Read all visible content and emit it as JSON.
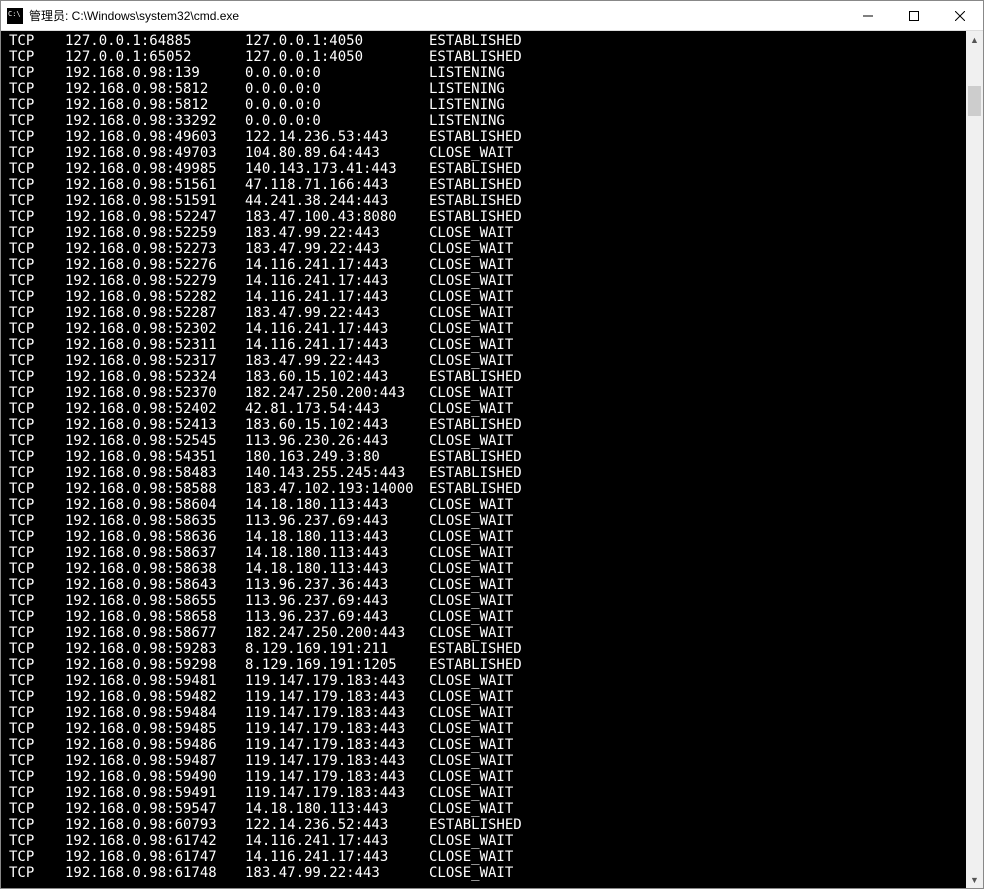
{
  "window": {
    "title": "管理员: C:\\Windows\\system32\\cmd.exe"
  },
  "connections": [
    {
      "proto": "TCP",
      "local": "127.0.0.1:64885",
      "remote": "127.0.0.1:4050",
      "state": "ESTABLISHED"
    },
    {
      "proto": "TCP",
      "local": "127.0.0.1:65052",
      "remote": "127.0.0.1:4050",
      "state": "ESTABLISHED"
    },
    {
      "proto": "TCP",
      "local": "192.168.0.98:139",
      "remote": "0.0.0.0:0",
      "state": "LISTENING"
    },
    {
      "proto": "TCP",
      "local": "192.168.0.98:5812",
      "remote": "0.0.0.0:0",
      "state": "LISTENING"
    },
    {
      "proto": "TCP",
      "local": "192.168.0.98:5812",
      "remote": "0.0.0.0:0",
      "state": "LISTENING"
    },
    {
      "proto": "TCP",
      "local": "192.168.0.98:33292",
      "remote": "0.0.0.0:0",
      "state": "LISTENING"
    },
    {
      "proto": "TCP",
      "local": "192.168.0.98:49603",
      "remote": "122.14.236.53:443",
      "state": "ESTABLISHED"
    },
    {
      "proto": "TCP",
      "local": "192.168.0.98:49703",
      "remote": "104.80.89.64:443",
      "state": "CLOSE_WAIT"
    },
    {
      "proto": "TCP",
      "local": "192.168.0.98:49985",
      "remote": "140.143.173.41:443",
      "state": "ESTABLISHED"
    },
    {
      "proto": "TCP",
      "local": "192.168.0.98:51561",
      "remote": "47.118.71.166:443",
      "state": "ESTABLISHED"
    },
    {
      "proto": "TCP",
      "local": "192.168.0.98:51591",
      "remote": "44.241.38.244:443",
      "state": "ESTABLISHED"
    },
    {
      "proto": "TCP",
      "local": "192.168.0.98:52247",
      "remote": "183.47.100.43:8080",
      "state": "ESTABLISHED"
    },
    {
      "proto": "TCP",
      "local": "192.168.0.98:52259",
      "remote": "183.47.99.22:443",
      "state": "CLOSE_WAIT"
    },
    {
      "proto": "TCP",
      "local": "192.168.0.98:52273",
      "remote": "183.47.99.22:443",
      "state": "CLOSE_WAIT"
    },
    {
      "proto": "TCP",
      "local": "192.168.0.98:52276",
      "remote": "14.116.241.17:443",
      "state": "CLOSE_WAIT"
    },
    {
      "proto": "TCP",
      "local": "192.168.0.98:52279",
      "remote": "14.116.241.17:443",
      "state": "CLOSE_WAIT"
    },
    {
      "proto": "TCP",
      "local": "192.168.0.98:52282",
      "remote": "14.116.241.17:443",
      "state": "CLOSE_WAIT"
    },
    {
      "proto": "TCP",
      "local": "192.168.0.98:52287",
      "remote": "183.47.99.22:443",
      "state": "CLOSE_WAIT"
    },
    {
      "proto": "TCP",
      "local": "192.168.0.98:52302",
      "remote": "14.116.241.17:443",
      "state": "CLOSE_WAIT"
    },
    {
      "proto": "TCP",
      "local": "192.168.0.98:52311",
      "remote": "14.116.241.17:443",
      "state": "CLOSE_WAIT"
    },
    {
      "proto": "TCP",
      "local": "192.168.0.98:52317",
      "remote": "183.47.99.22:443",
      "state": "CLOSE_WAIT"
    },
    {
      "proto": "TCP",
      "local": "192.168.0.98:52324",
      "remote": "183.60.15.102:443",
      "state": "ESTABLISHED"
    },
    {
      "proto": "TCP",
      "local": "192.168.0.98:52370",
      "remote": "182.247.250.200:443",
      "state": "CLOSE_WAIT"
    },
    {
      "proto": "TCP",
      "local": "192.168.0.98:52402",
      "remote": "42.81.173.54:443",
      "state": "CLOSE_WAIT"
    },
    {
      "proto": "TCP",
      "local": "192.168.0.98:52413",
      "remote": "183.60.15.102:443",
      "state": "ESTABLISHED"
    },
    {
      "proto": "TCP",
      "local": "192.168.0.98:52545",
      "remote": "113.96.230.26:443",
      "state": "CLOSE_WAIT"
    },
    {
      "proto": "TCP",
      "local": "192.168.0.98:54351",
      "remote": "180.163.249.3:80",
      "state": "ESTABLISHED"
    },
    {
      "proto": "TCP",
      "local": "192.168.0.98:58483",
      "remote": "140.143.255.245:443",
      "state": "ESTABLISHED"
    },
    {
      "proto": "TCP",
      "local": "192.168.0.98:58588",
      "remote": "183.47.102.193:14000",
      "state": "ESTABLISHED"
    },
    {
      "proto": "TCP",
      "local": "192.168.0.98:58604",
      "remote": "14.18.180.113:443",
      "state": "CLOSE_WAIT"
    },
    {
      "proto": "TCP",
      "local": "192.168.0.98:58635",
      "remote": "113.96.237.69:443",
      "state": "CLOSE_WAIT"
    },
    {
      "proto": "TCP",
      "local": "192.168.0.98:58636",
      "remote": "14.18.180.113:443",
      "state": "CLOSE_WAIT"
    },
    {
      "proto": "TCP",
      "local": "192.168.0.98:58637",
      "remote": "14.18.180.113:443",
      "state": "CLOSE_WAIT"
    },
    {
      "proto": "TCP",
      "local": "192.168.0.98:58638",
      "remote": "14.18.180.113:443",
      "state": "CLOSE_WAIT"
    },
    {
      "proto": "TCP",
      "local": "192.168.0.98:58643",
      "remote": "113.96.237.36:443",
      "state": "CLOSE_WAIT"
    },
    {
      "proto": "TCP",
      "local": "192.168.0.98:58655",
      "remote": "113.96.237.69:443",
      "state": "CLOSE_WAIT"
    },
    {
      "proto": "TCP",
      "local": "192.168.0.98:58658",
      "remote": "113.96.237.69:443",
      "state": "CLOSE_WAIT"
    },
    {
      "proto": "TCP",
      "local": "192.168.0.98:58677",
      "remote": "182.247.250.200:443",
      "state": "CLOSE_WAIT"
    },
    {
      "proto": "TCP",
      "local": "192.168.0.98:59283",
      "remote": "8.129.169.191:211",
      "state": "ESTABLISHED"
    },
    {
      "proto": "TCP",
      "local": "192.168.0.98:59298",
      "remote": "8.129.169.191:1205",
      "state": "ESTABLISHED"
    },
    {
      "proto": "TCP",
      "local": "192.168.0.98:59481",
      "remote": "119.147.179.183:443",
      "state": "CLOSE_WAIT"
    },
    {
      "proto": "TCP",
      "local": "192.168.0.98:59482",
      "remote": "119.147.179.183:443",
      "state": "CLOSE_WAIT"
    },
    {
      "proto": "TCP",
      "local": "192.168.0.98:59484",
      "remote": "119.147.179.183:443",
      "state": "CLOSE_WAIT"
    },
    {
      "proto": "TCP",
      "local": "192.168.0.98:59485",
      "remote": "119.147.179.183:443",
      "state": "CLOSE_WAIT"
    },
    {
      "proto": "TCP",
      "local": "192.168.0.98:59486",
      "remote": "119.147.179.183:443",
      "state": "CLOSE_WAIT"
    },
    {
      "proto": "TCP",
      "local": "192.168.0.98:59487",
      "remote": "119.147.179.183:443",
      "state": "CLOSE_WAIT"
    },
    {
      "proto": "TCP",
      "local": "192.168.0.98:59490",
      "remote": "119.147.179.183:443",
      "state": "CLOSE_WAIT"
    },
    {
      "proto": "TCP",
      "local": "192.168.0.98:59491",
      "remote": "119.147.179.183:443",
      "state": "CLOSE_WAIT"
    },
    {
      "proto": "TCP",
      "local": "192.168.0.98:59547",
      "remote": "14.18.180.113:443",
      "state": "CLOSE_WAIT"
    },
    {
      "proto": "TCP",
      "local": "192.168.0.98:60793",
      "remote": "122.14.236.52:443",
      "state": "ESTABLISHED"
    },
    {
      "proto": "TCP",
      "local": "192.168.0.98:61742",
      "remote": "14.116.241.17:443",
      "state": "CLOSE_WAIT"
    },
    {
      "proto": "TCP",
      "local": "192.168.0.98:61747",
      "remote": "14.116.241.17:443",
      "state": "CLOSE_WAIT"
    },
    {
      "proto": "TCP",
      "local": "192.168.0.98:61748",
      "remote": "183.47.99.22:443",
      "state": "CLOSE_WAIT"
    }
  ]
}
